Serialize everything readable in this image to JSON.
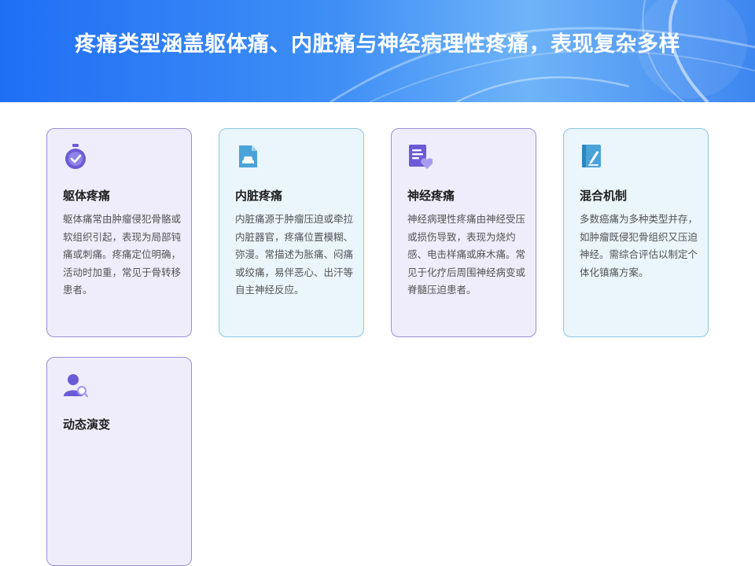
{
  "header": {
    "title": "疼痛类型涵盖躯体痛、内脏痛与神经病理性疼痛，表现复杂多样"
  },
  "colors": {
    "banner_blue": "#1f6ff5",
    "purple_accent": "#6b5bd6",
    "blue_accent": "#4aa3d8",
    "purple_card_bg": "#efedfb",
    "blue_card_bg": "#eaf5fc"
  },
  "cards": [
    {
      "icon": "stopwatch-check-icon",
      "title": "躯体疼痛",
      "text": "躯体痛常由肿瘤侵犯骨骼或软组织引起，表现为局部钝痛或刺痛。疼痛定位明确，活动时加重，常见于骨转移患者。"
    },
    {
      "icon": "car-document-icon",
      "title": "内脏疼痛",
      "text": "内脏痛源于肿瘤压迫或牵拉内脏器官，疼痛位置模糊、弥漫。常描述为胀痛、闷痛或绞痛，易伴恶心、出汗等自主神经反应。"
    },
    {
      "icon": "document-heart-icon",
      "title": "神经疼痛",
      "text": "神经病理性疼痛由神经受压或损伤导致，表现为烧灼感、电击样痛或麻木痛。常见于化疗后周围神经病变或脊髓压迫患者。"
    },
    {
      "icon": "notebook-pen-icon",
      "title": "混合机制",
      "text": "多数癌痛为多种类型并存，如肿瘤既侵犯骨组织又压迫神经。需综合评估以制定个体化镇痛方案。"
    },
    {
      "icon": "user-search-icon",
      "title": "动态演变",
      "text": ""
    }
  ]
}
